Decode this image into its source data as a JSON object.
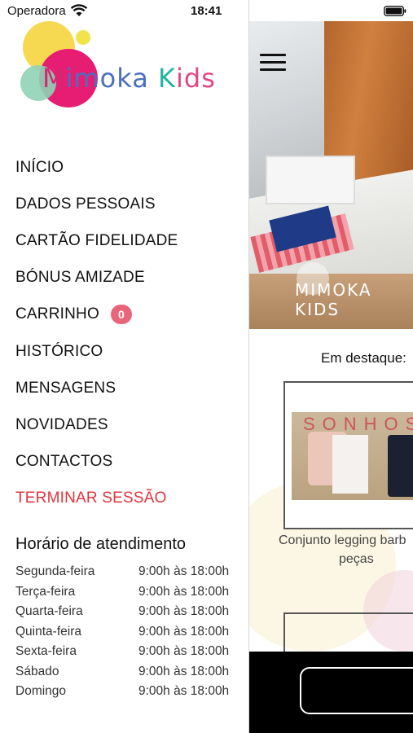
{
  "status_bar": {
    "carrier": "Operadora",
    "time": "18:41",
    "icons": [
      "wifi-icon",
      "battery-icon"
    ]
  },
  "drawer": {
    "logo": {
      "text_parts": [
        "M",
        "imoka ",
        "K",
        "ids"
      ],
      "colors": [
        "#d3276f",
        "#4a6fbf",
        "#21b5a1",
        "#e24587",
        "#f6c93b",
        "#f6e020"
      ]
    },
    "menu": [
      {
        "label": "INÍCIO"
      },
      {
        "label": "DADOS PESSOAIS"
      },
      {
        "label": "CARTÃO FIDELIDADE"
      },
      {
        "label": "BÓNUS AMIZADE"
      },
      {
        "label": "CARRINHO",
        "badge": "0"
      },
      {
        "label": "HISTÓRICO"
      },
      {
        "label": "MENSAGENS"
      },
      {
        "label": "NOVIDADES"
      },
      {
        "label": "CONTACTOS"
      },
      {
        "label": "TERMINAR SESSÃO",
        "color": "#e1343d"
      }
    ],
    "badge_color": "#e9657a",
    "hours": {
      "title": "Horário de atendimento",
      "rows": [
        {
          "day": "Segunda-feira",
          "time": "9:00h às 18:00h"
        },
        {
          "day": "Terça-feira",
          "time": "9:00h às 18:00h"
        },
        {
          "day": "Quarta-feira",
          "time": "9:00h às 18:00h"
        },
        {
          "day": "Quinta-feira",
          "time": "9:00h às 18:00h"
        },
        {
          "day": "Sexta-feira",
          "time": "9:00h às 18:00h"
        },
        {
          "day": "Sábado",
          "time": "9:00h às 18:00h"
        },
        {
          "day": "Domingo",
          "time": "9:00h às 18:00h"
        }
      ]
    }
  },
  "main": {
    "menu_icon": "hamburger-menu-icon",
    "hero_logo": "MIMOKA KIDS",
    "featured_label": "Em destaque:",
    "products": [
      {
        "title_line1": "Conjunto legging barb",
        "title_line2": "peças",
        "image_text": "SONHOS"
      }
    ]
  }
}
